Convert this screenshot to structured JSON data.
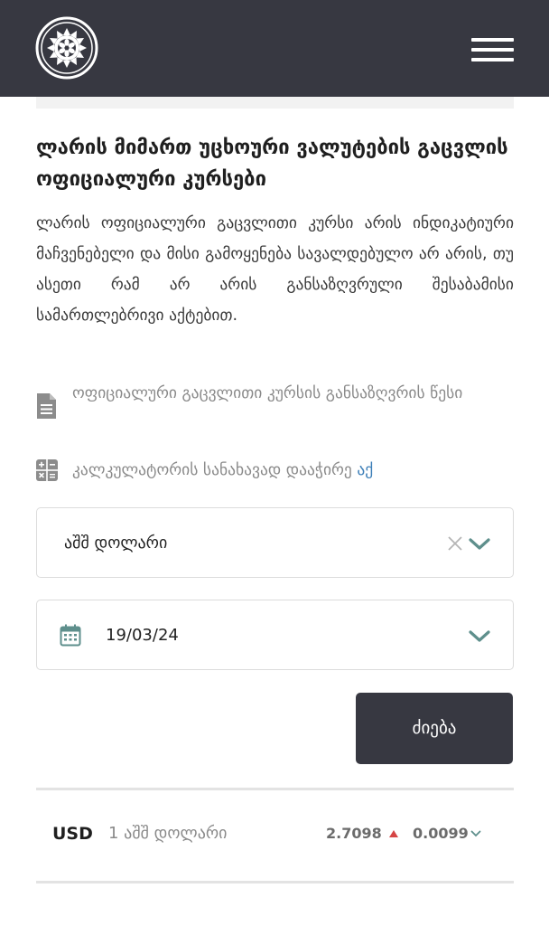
{
  "header": {
    "logo_icon": "sun-emblem-icon",
    "menu_icon": "hamburger-menu-icon"
  },
  "title": "ლარის მიმართ უცხოური ვალუტების გაცვლის ოფიციალური კურსები",
  "description": "ლარის ოფიციალური გაცვლითი კურსი არის ინდიკატიური მაჩვენებელი და მისი გამოყენება სავალდებულო არ არის, თუ ასეთი რამ არ არის განსაზღვრული შესაბამისი სამართლებრივი აქტებით.",
  "links": {
    "rules_text": "ოფიციალური გაცვლითი კურსის განსაზღვრის წესი",
    "calculator_text": "კალკულატორის სანახავად დააჭირე",
    "calculator_link": "აქ"
  },
  "currency_select": {
    "value": "აშშ დოლარი"
  },
  "date_field": {
    "value": "19/03/24"
  },
  "search_button": "ძიება",
  "rates": [
    {
      "code": "USD",
      "name": "1 აშშ დოლარი",
      "rate": "2.7098",
      "change": "0.0099",
      "direction": "up"
    }
  ],
  "colors": {
    "header_bg": "#373841",
    "accent_teal": "#5e8f8c",
    "link_blue": "#3d7fb8",
    "up_red": "#d64545"
  }
}
